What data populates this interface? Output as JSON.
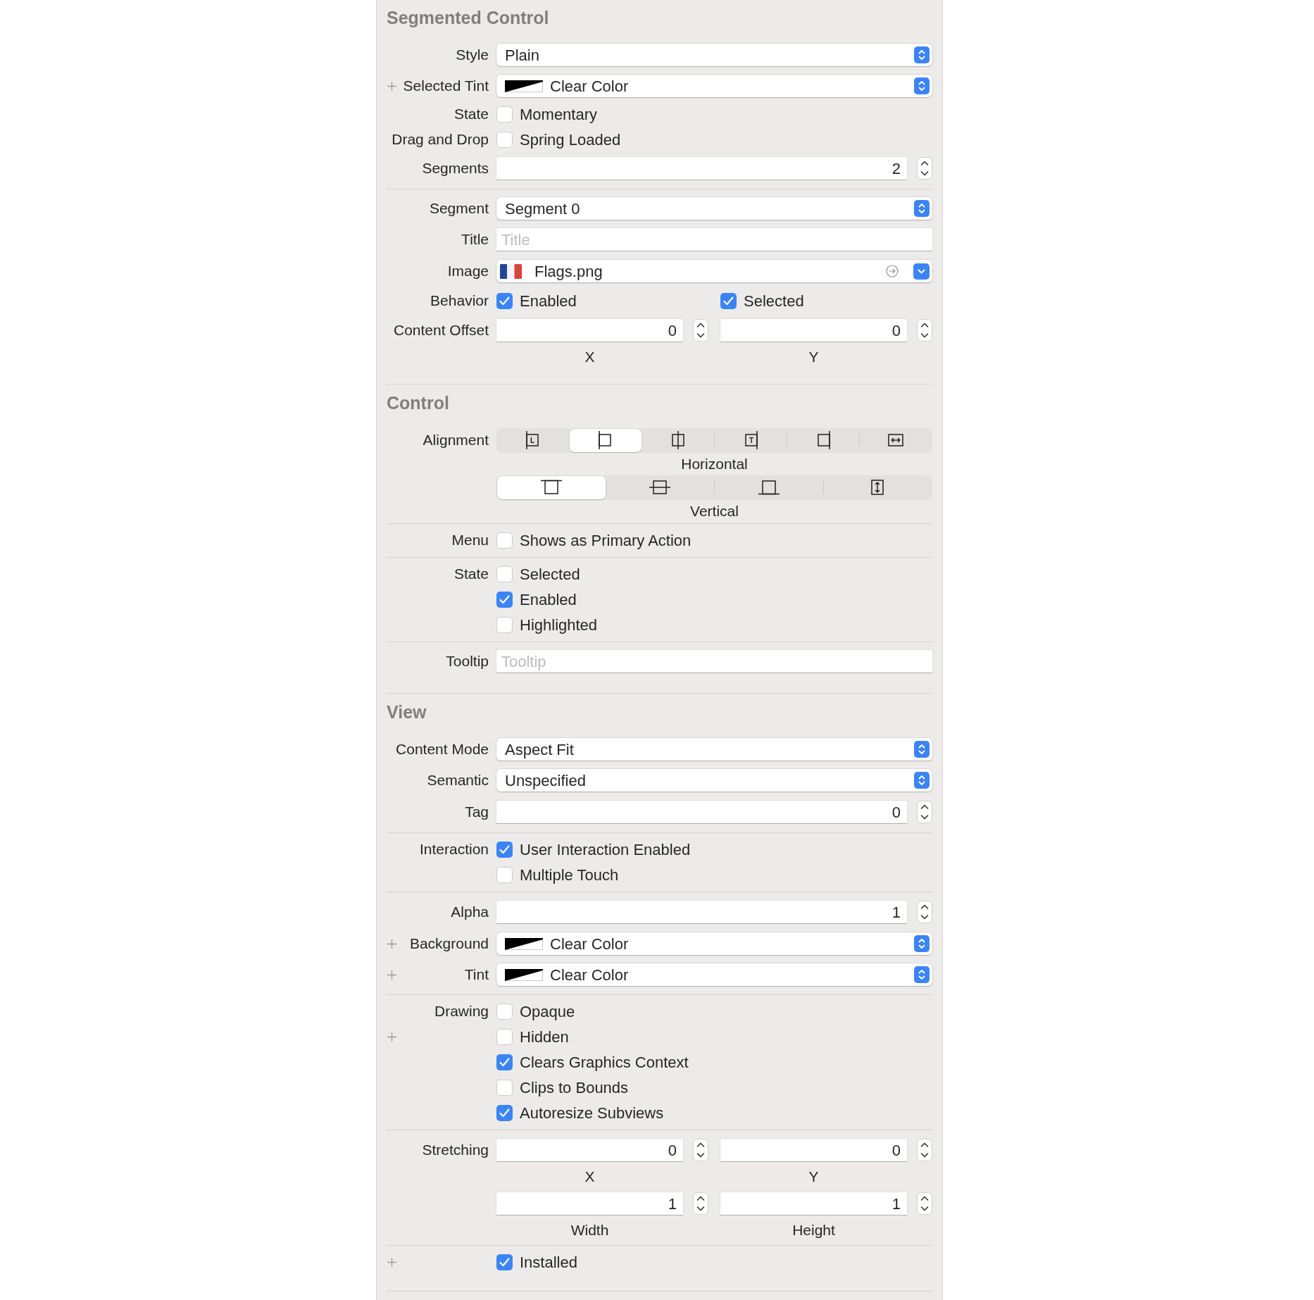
{
  "sections": [
    {
      "title": "Segmented Control",
      "groups": [
        {
          "rows": [
            {
              "kind": "popup",
              "label": "Style",
              "value": "Plain"
            },
            {
              "kind": "color",
              "label": "Selected Tint",
              "plus_button": true,
              "value": "Clear Color"
            },
            {
              "kind": "checks",
              "label": "State",
              "items": [
                {
                  "label": "Momentary",
                  "checked": false
                }
              ]
            },
            {
              "kind": "checks",
              "label": "Drag and Drop",
              "items": [
                {
                  "label": "Spring Loaded",
                  "checked": false
                }
              ]
            },
            {
              "kind": "stepper",
              "label": "Segments",
              "value": "2"
            }
          ]
        },
        {
          "rows": [
            {
              "kind": "popup",
              "label": "Segment",
              "value": "Segment 0"
            },
            {
              "kind": "text",
              "label": "Title",
              "placeholder": "Title"
            },
            {
              "kind": "image",
              "label": "Image",
              "value": "Flags.png"
            },
            {
              "kind": "check_pair",
              "label": "Behavior",
              "items": [
                {
                  "label": "Enabled",
                  "checked": true
                },
                {
                  "label": "Selected",
                  "checked": true
                }
              ]
            },
            {
              "kind": "stepper_pairs",
              "label": "Content Offset",
              "fields": [
                {
                  "value": "0",
                  "caption": "X"
                },
                {
                  "value": "0",
                  "caption": "Y"
                }
              ]
            }
          ]
        }
      ]
    },
    {
      "title": "Control",
      "groups": [
        {
          "rows": [
            {
              "kind": "alignment",
              "label": "Alignment",
              "controls": [
                {
                  "caption": "Horizontal",
                  "segments": [
                    {
                      "glyph": "L",
                      "selected": false
                    },
                    {
                      "selected": true
                    },
                    {
                      "selected": false
                    },
                    {
                      "glyph": "T",
                      "selected": false
                    },
                    {
                      "selected": false
                    },
                    {
                      "selected": false
                    }
                  ]
                },
                {
                  "caption": "Vertical",
                  "segments": [
                    {
                      "selected": true
                    },
                    {
                      "selected": false
                    },
                    {
                      "selected": false
                    },
                    {
                      "selected": false
                    }
                  ]
                }
              ]
            }
          ]
        },
        {
          "rows": [
            {
              "kind": "checks",
              "label": "Menu",
              "items": [
                {
                  "label": "Shows as Primary Action",
                  "checked": false
                }
              ]
            }
          ]
        },
        {
          "rows": [
            {
              "kind": "checks",
              "label": "State",
              "items": [
                {
                  "label": "Selected",
                  "checked": false
                },
                {
                  "label": "Enabled",
                  "checked": true
                },
                {
                  "label": "Highlighted",
                  "checked": false
                }
              ]
            }
          ]
        },
        {
          "rows": [
            {
              "kind": "text",
              "label": "Tooltip",
              "placeholder": "Tooltip"
            }
          ]
        }
      ]
    },
    {
      "title": "View",
      "groups": [
        {
          "rows": [
            {
              "kind": "popup",
              "label": "Content Mode",
              "value": "Aspect Fit"
            },
            {
              "kind": "popup",
              "label": "Semantic",
              "value": "Unspecified"
            },
            {
              "kind": "stepper",
              "label": "Tag",
              "value": "0"
            }
          ]
        },
        {
          "rows": [
            {
              "kind": "checks",
              "label": "Interaction",
              "items": [
                {
                  "label": "User Interaction Enabled",
                  "checked": true
                },
                {
                  "label": "Multiple Touch",
                  "checked": false
                }
              ]
            }
          ]
        },
        {
          "rows": [
            {
              "kind": "stepper",
              "label": "Alpha",
              "value": "1"
            },
            {
              "kind": "color",
              "label": "Background",
              "plus_button": true,
              "value": "Clear Color"
            },
            {
              "kind": "color",
              "label": "Tint",
              "plus_button": true,
              "value": "Clear Color"
            }
          ]
        },
        {
          "rows": [
            {
              "kind": "checks",
              "label": "Drawing",
              "items": [
                {
                  "label": "Opaque",
                  "checked": false
                },
                {
                  "label": "Hidden",
                  "checked": false,
                  "plus_button": true
                },
                {
                  "label": "Clears Graphics Context",
                  "checked": true
                },
                {
                  "label": "Clips to Bounds",
                  "checked": false
                },
                {
                  "label": "Autoresize Subviews",
                  "checked": true
                }
              ]
            }
          ]
        },
        {
          "rows": [
            {
              "kind": "stepper_pairs",
              "label": "Stretching",
              "fields": [
                {
                  "value": "0",
                  "caption": "X"
                },
                {
                  "value": "0",
                  "caption": "Y"
                },
                {
                  "value": "1",
                  "caption": "Width"
                },
                {
                  "value": "1",
                  "caption": "Height"
                }
              ]
            }
          ]
        },
        {
          "rows": [
            {
              "kind": "checks",
              "plus_button": true,
              "items": [
                {
                  "label": "Installed",
                  "checked": true
                }
              ]
            }
          ]
        }
      ]
    }
  ]
}
